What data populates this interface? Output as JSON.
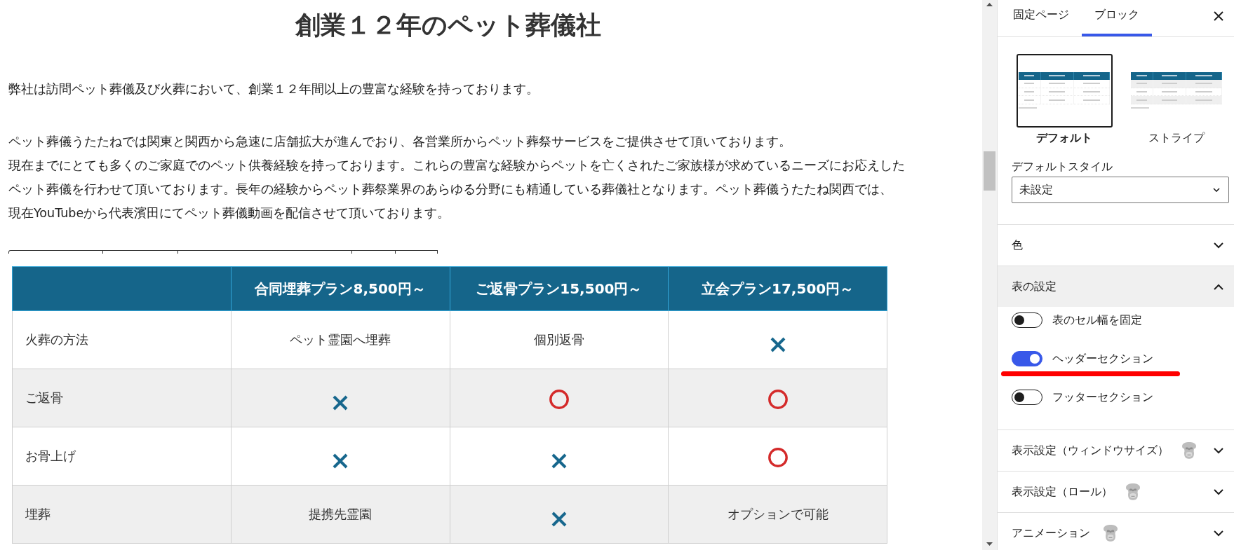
{
  "editor": {
    "heading": "創業１２年のペット葬儀社",
    "paragraphs": [
      {
        "lines": [
          "弊社は訪問ペット葬儀及び火葬において、創業１２年間以上の豊富な経験を持っております。"
        ]
      },
      {
        "lines": [
          "ペット葬儀うたたねでは関東と関西から急速に店舗拡大が進んでおり、各営業所からペット葬祭サービスをご提供させて頂いております。",
          "現在までにとても多くのご家庭でのペット供養経験を持っております。これらの豊富な経験からペットを亡くされたご家族様が求めているニーズにお応えした",
          "ペット葬儀を行わせて頂いております。長年の経験からペット葬祭業界のあらゆる分野にも精通している葬儀社となります。ペット葬儀うたたね関西では、",
          "現在YouTubeから代表濱田にてペット葬儀動画を配信させて頂いております。"
        ]
      }
    ],
    "table": {
      "columns": [
        "合同埋葬プラン8,500円～",
        "ご返骨プラン15,500円～",
        "立会プラン17,500円～"
      ],
      "rows": [
        {
          "label": "火葬の方法",
          "cells": [
            {
              "kind": "text",
              "text": "ペット霊園へ埋葬"
            },
            {
              "kind": "text",
              "text": "個別返骨"
            },
            {
              "kind": "cross"
            }
          ]
        },
        {
          "label": "ご返骨",
          "cells": [
            {
              "kind": "cross"
            },
            {
              "kind": "circle"
            },
            {
              "kind": "circle"
            }
          ]
        },
        {
          "label": "お骨上げ",
          "cells": [
            {
              "kind": "cross"
            },
            {
              "kind": "cross"
            },
            {
              "kind": "circle"
            }
          ]
        },
        {
          "label": "埋葬",
          "cells": [
            {
              "kind": "text",
              "text": "提携先霊園"
            },
            {
              "kind": "cross"
            },
            {
              "kind": "text",
              "text": "オプションで可能"
            }
          ]
        }
      ]
    }
  },
  "sidebar": {
    "tabs": [
      {
        "label": "固定ページ",
        "selected": false
      },
      {
        "label": "ブロック",
        "selected": true
      }
    ],
    "styles": [
      {
        "kind": "default",
        "label": "デフォルト",
        "selected": true
      },
      {
        "kind": "stripe",
        "label": "ストライプ",
        "selected": false
      }
    ],
    "default_style": {
      "label": "デフォルトスタイル",
      "value": "未設定"
    },
    "panels": [
      {
        "title": "色",
        "expanded": false
      },
      {
        "title": "表の設定",
        "expanded": true,
        "toggles": [
          {
            "label": "表のセル幅を固定",
            "on": false
          },
          {
            "label": "ヘッダーセクション",
            "on": true,
            "underlined": true
          },
          {
            "label": "フッターセクション",
            "on": false
          }
        ]
      },
      {
        "title": "表示設定（ウィンドウサイズ）",
        "expanded": false,
        "has_icon": true
      },
      {
        "title": "表示設定（ロール）",
        "expanded": false,
        "has_icon": true
      },
      {
        "title": "アニメーション",
        "expanded": false,
        "has_icon": true
      }
    ]
  }
}
